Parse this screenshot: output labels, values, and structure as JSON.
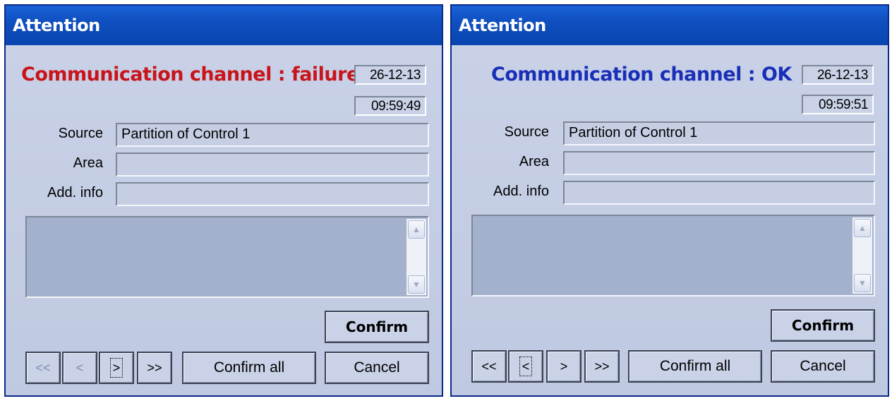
{
  "left": {
    "title": "Attention",
    "headline": "Communication channel : failure",
    "headline_color": "#c8141a",
    "date": "26-12-13",
    "time": "09:59:49",
    "labels": {
      "source": "Source",
      "area": "Area",
      "add_info": "Add. info"
    },
    "fields": {
      "source": "Partition of Control 1",
      "area": "",
      "add_info": ""
    },
    "buttons": {
      "confirm": "Confirm",
      "first": "<<",
      "prev": "<",
      "next": ">",
      "last": ">>",
      "confirm_all": "Confirm all",
      "cancel": "Cancel"
    }
  },
  "right": {
    "title": "Attention",
    "headline": "Communication channel : OK",
    "headline_color": "#1a2fb8",
    "date": "26-12-13",
    "time": "09:59:51",
    "labels": {
      "source": "Source",
      "area": "Area",
      "add_info": "Add. info"
    },
    "fields": {
      "source": "Partition of Control 1",
      "area": "",
      "add_info": ""
    },
    "buttons": {
      "confirm": "Confirm",
      "first": "<<",
      "prev": "<",
      "next": ">",
      "last": ">>",
      "confirm_all": "Confirm all",
      "cancel": "Cancel"
    }
  }
}
